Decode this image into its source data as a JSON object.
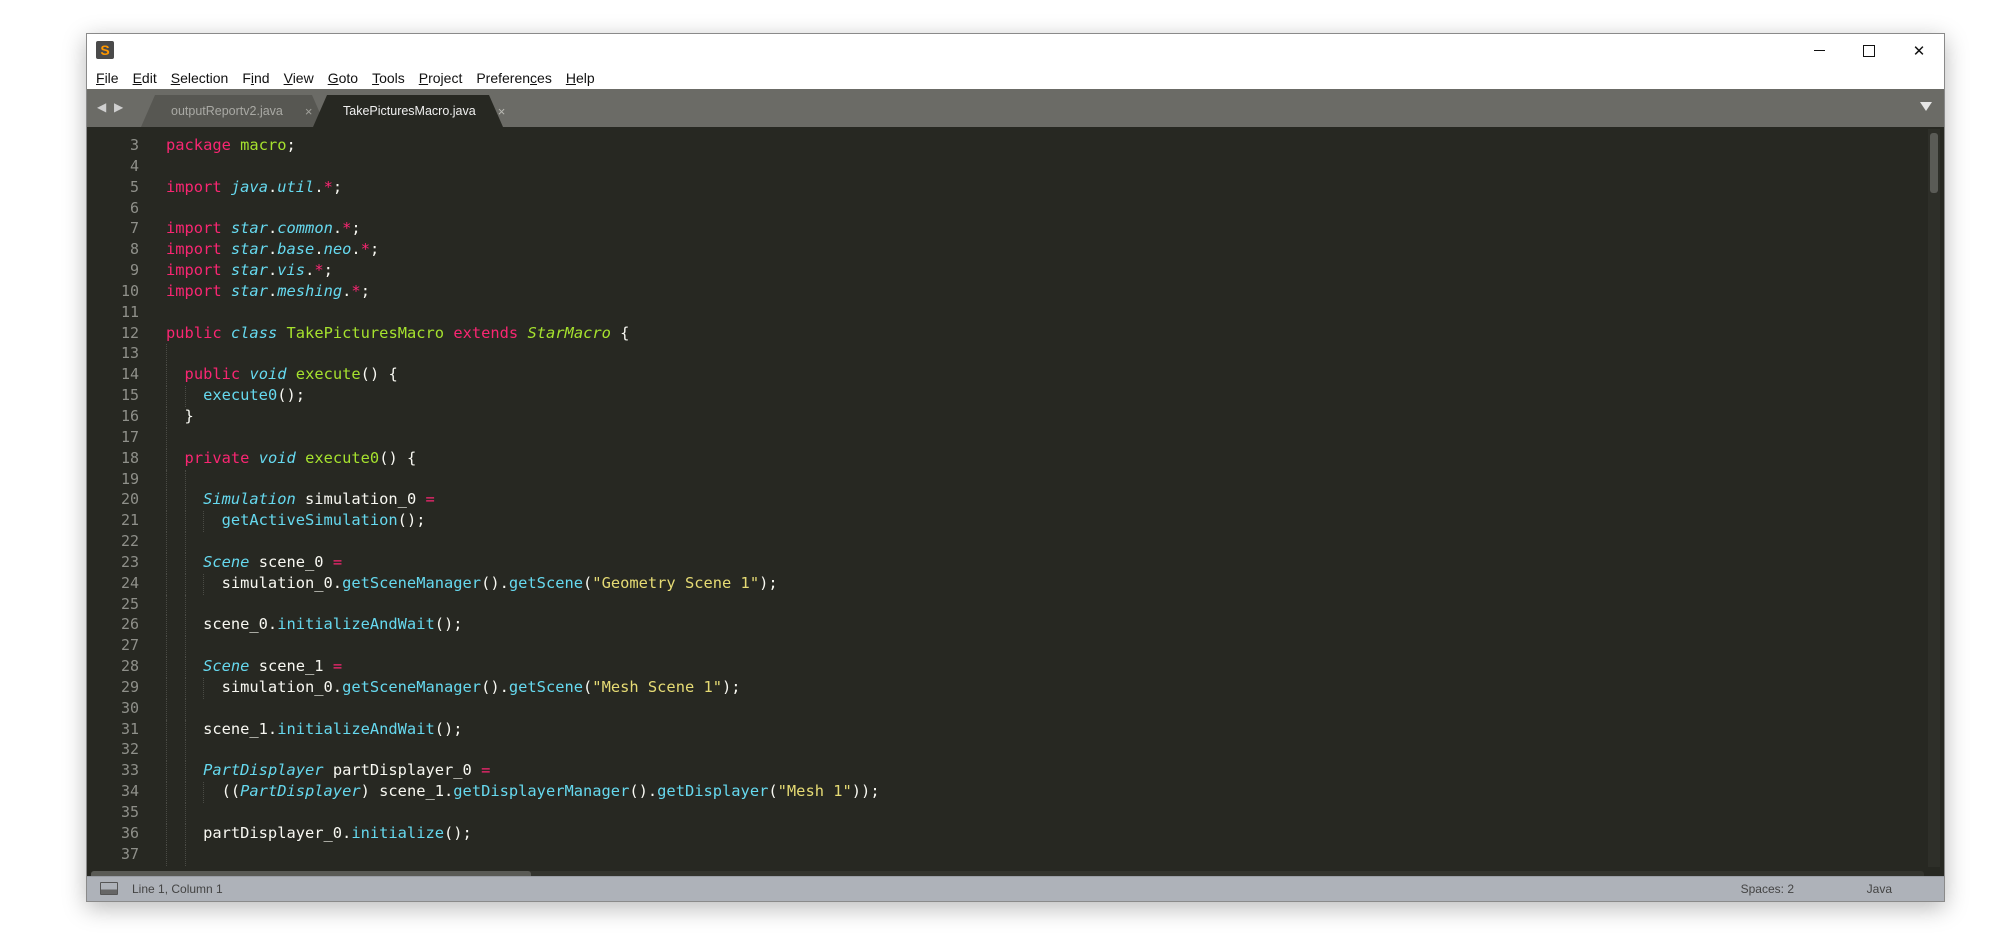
{
  "window": {
    "app_icon": "sublime-text-logo",
    "controls": {
      "minimize": "minimize-icon",
      "maximize": "maximize-icon",
      "close": "close-icon"
    }
  },
  "menu": [
    {
      "label": "File",
      "mnemonic_index": 0
    },
    {
      "label": "Edit",
      "mnemonic_index": 0
    },
    {
      "label": "Selection",
      "mnemonic_index": 0
    },
    {
      "label": "Find",
      "mnemonic_index": 1
    },
    {
      "label": "View",
      "mnemonic_index": 0
    },
    {
      "label": "Goto",
      "mnemonic_index": 0
    },
    {
      "label": "Tools",
      "mnemonic_index": 0
    },
    {
      "label": "Project",
      "mnemonic_index": 0
    },
    {
      "label": "Preferences",
      "mnemonic_index": 8
    },
    {
      "label": "Help",
      "mnemonic_index": 0
    }
  ],
  "tabs": [
    {
      "label": "outputReportv2.java",
      "active": false,
      "close": "×"
    },
    {
      "label": "TakePicturesMacro.java",
      "active": true,
      "close": "×"
    }
  ],
  "tab_nav": "◀ ▶",
  "editor": {
    "first_line": 3,
    "lines": [
      [
        [
          "k",
          "package"
        ],
        [
          "p",
          " "
        ],
        [
          "c",
          "macro"
        ],
        [
          "p",
          ";"
        ]
      ],
      [],
      [
        [
          "k",
          "import"
        ],
        [
          "p",
          " "
        ],
        [
          "t",
          "java"
        ],
        [
          "p",
          "."
        ],
        [
          "t",
          "util"
        ],
        [
          "p",
          "."
        ],
        [
          "k",
          "*"
        ],
        [
          "p",
          ";"
        ]
      ],
      [],
      [
        [
          "k",
          "import"
        ],
        [
          "p",
          " "
        ],
        [
          "t",
          "star"
        ],
        [
          "p",
          "."
        ],
        [
          "t",
          "common"
        ],
        [
          "p",
          "."
        ],
        [
          "k",
          "*"
        ],
        [
          "p",
          ";"
        ]
      ],
      [
        [
          "k",
          "import"
        ],
        [
          "p",
          " "
        ],
        [
          "t",
          "star"
        ],
        [
          "p",
          "."
        ],
        [
          "t",
          "base"
        ],
        [
          "p",
          "."
        ],
        [
          "t",
          "neo"
        ],
        [
          "p",
          "."
        ],
        [
          "k",
          "*"
        ],
        [
          "p",
          ";"
        ]
      ],
      [
        [
          "k",
          "import"
        ],
        [
          "p",
          " "
        ],
        [
          "t",
          "star"
        ],
        [
          "p",
          "."
        ],
        [
          "t",
          "vis"
        ],
        [
          "p",
          "."
        ],
        [
          "k",
          "*"
        ],
        [
          "p",
          ";"
        ]
      ],
      [
        [
          "k",
          "import"
        ],
        [
          "p",
          " "
        ],
        [
          "t",
          "star"
        ],
        [
          "p",
          "."
        ],
        [
          "t",
          "meshing"
        ],
        [
          "p",
          "."
        ],
        [
          "k",
          "*"
        ],
        [
          "p",
          ";"
        ]
      ],
      [],
      [
        [
          "k",
          "public"
        ],
        [
          "p",
          " "
        ],
        [
          "t",
          "class"
        ],
        [
          "p",
          " "
        ],
        [
          "f",
          "TakePicturesMacro"
        ],
        [
          "p",
          " "
        ],
        [
          "k",
          "extends"
        ],
        [
          "p",
          " "
        ],
        [
          "fi",
          "StarMacro"
        ],
        [
          "p",
          " {"
        ]
      ],
      [],
      [
        [
          "p",
          "  "
        ],
        [
          "k",
          "public"
        ],
        [
          "p",
          " "
        ],
        [
          "t",
          "void"
        ],
        [
          "p",
          " "
        ],
        [
          "f",
          "execute"
        ],
        [
          "p",
          "() {"
        ]
      ],
      [
        [
          "p",
          "    "
        ],
        [
          "m",
          "execute0"
        ],
        [
          "p",
          "();"
        ]
      ],
      [
        [
          "p",
          "  }"
        ]
      ],
      [],
      [
        [
          "p",
          "  "
        ],
        [
          "k",
          "private"
        ],
        [
          "p",
          " "
        ],
        [
          "t",
          "void"
        ],
        [
          "p",
          " "
        ],
        [
          "f",
          "execute0"
        ],
        [
          "p",
          "() {"
        ]
      ],
      [],
      [
        [
          "p",
          "    "
        ],
        [
          "t",
          "Simulation"
        ],
        [
          "p",
          " simulation_0 "
        ],
        [
          "k",
          "="
        ]
      ],
      [
        [
          "p",
          "      "
        ],
        [
          "m",
          "getActiveSimulation"
        ],
        [
          "p",
          "();"
        ]
      ],
      [],
      [
        [
          "p",
          "    "
        ],
        [
          "t",
          "Scene"
        ],
        [
          "p",
          " scene_0 "
        ],
        [
          "k",
          "="
        ]
      ],
      [
        [
          "p",
          "      simulation_0."
        ],
        [
          "m",
          "getSceneManager"
        ],
        [
          "p",
          "()."
        ],
        [
          "m",
          "getScene"
        ],
        [
          "p",
          "("
        ],
        [
          "s",
          "\"Geometry Scene 1\""
        ],
        [
          "p",
          ");"
        ]
      ],
      [],
      [
        [
          "p",
          "    scene_0."
        ],
        [
          "m",
          "initializeAndWait"
        ],
        [
          "p",
          "();"
        ]
      ],
      [],
      [
        [
          "p",
          "    "
        ],
        [
          "t",
          "Scene"
        ],
        [
          "p",
          " scene_1 "
        ],
        [
          "k",
          "="
        ]
      ],
      [
        [
          "p",
          "      simulation_0."
        ],
        [
          "m",
          "getSceneManager"
        ],
        [
          "p",
          "()."
        ],
        [
          "m",
          "getScene"
        ],
        [
          "p",
          "("
        ],
        [
          "s",
          "\"Mesh Scene 1\""
        ],
        [
          "p",
          ");"
        ]
      ],
      [],
      [
        [
          "p",
          "    scene_1."
        ],
        [
          "m",
          "initializeAndWait"
        ],
        [
          "p",
          "();"
        ]
      ],
      [],
      [
        [
          "p",
          "    "
        ],
        [
          "t",
          "PartDisplayer"
        ],
        [
          "p",
          " partDisplayer_0 "
        ],
        [
          "k",
          "="
        ]
      ],
      [
        [
          "p",
          "      (("
        ],
        [
          "t",
          "PartDisplayer"
        ],
        [
          "p",
          ") scene_1."
        ],
        [
          "m",
          "getDisplayerManager"
        ],
        [
          "p",
          "()."
        ],
        [
          "m",
          "getDisplayer"
        ],
        [
          "p",
          "("
        ],
        [
          "s",
          "\"Mesh 1\""
        ],
        [
          "p",
          "));"
        ]
      ],
      [],
      [
        [
          "p",
          "    partDisplayer_0."
        ],
        [
          "m",
          "initialize"
        ],
        [
          "p",
          "();"
        ]
      ],
      []
    ]
  },
  "status": {
    "panel_icon": "console-panel-icon",
    "position": "Line 1, Column 1",
    "indentation": "Spaces: 2",
    "syntax": "Java"
  },
  "colors": {
    "editor_bg": "#272822",
    "keyword": "#f92672",
    "type": "#66d9ef",
    "function": "#a6e22e",
    "string": "#e6db74",
    "text": "#f8f8f2",
    "status_bg": "#aeb2b9",
    "tabbar_bg": "#6b6b66"
  }
}
